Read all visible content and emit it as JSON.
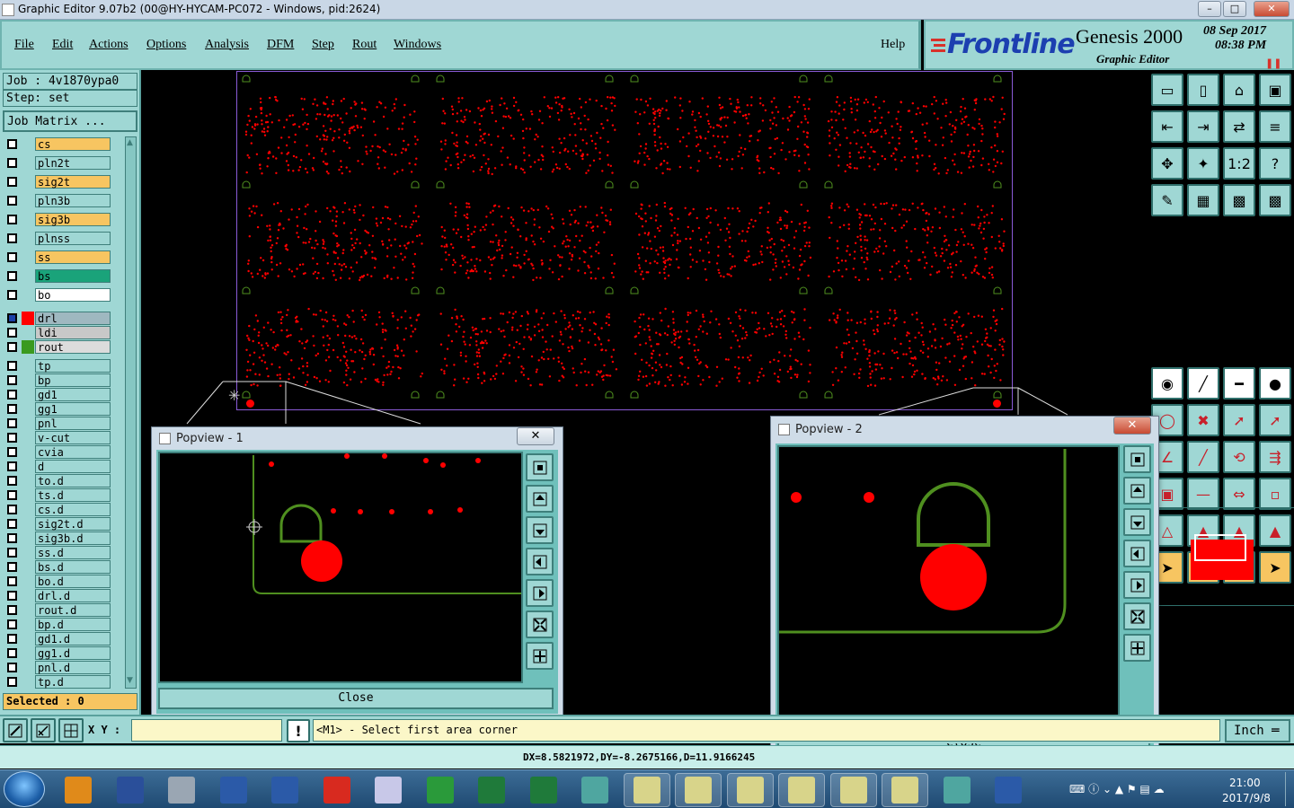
{
  "window": {
    "title": "Graphic Editor 9.07b2 (00@HY-HYCAM-PC072 - Windows, pid:2624)"
  },
  "menu": {
    "items": [
      "File",
      "Edit",
      "Actions",
      "Options",
      "Analysis",
      "DFM",
      "Step",
      "Rout",
      "Windows"
    ],
    "help": "Help"
  },
  "brand": {
    "logo": "Frontline",
    "product": "Genesis 2000",
    "subtitle": "Graphic Editor",
    "date": "08 Sep 2017",
    "time": "08:38 PM"
  },
  "job": {
    "job_label": "Job : 4v1870ypa0",
    "step_label": "Step: set",
    "matrix_button": "Job Matrix ..."
  },
  "layers": [
    {
      "name": "cs",
      "color": "#f7c561"
    },
    {
      "name": "pln2t",
      "color": "#9fd7d4"
    },
    {
      "name": "sig2t",
      "color": "#f7c561"
    },
    {
      "name": "pln3b",
      "color": "#9fd7d4"
    },
    {
      "name": "sig3b",
      "color": "#f7c561"
    },
    {
      "name": "plnss",
      "color": "#9fd7d4"
    },
    {
      "name": "ss",
      "color": "#f7c561"
    },
    {
      "name": "bs",
      "color": "#1aa37a"
    },
    {
      "name": "bo",
      "color": "#ffffff"
    },
    {
      "name": "drl",
      "color": "#9fb8c0",
      "swatch": "#ff0000",
      "selected": true
    },
    {
      "name": "ldi",
      "color": "#c8c8c8"
    },
    {
      "name": "rout",
      "color": "#dcdcdc",
      "swatch": "#3a9a1f"
    },
    {
      "name": "tp",
      "color": "#9fd7d4"
    },
    {
      "name": "bp",
      "color": "#9fd7d4"
    },
    {
      "name": "gd1",
      "color": "#9fd7d4"
    },
    {
      "name": "gg1",
      "color": "#9fd7d4"
    },
    {
      "name": "pnl",
      "color": "#9fd7d4"
    },
    {
      "name": "v-cut",
      "color": "#9fd7d4"
    },
    {
      "name": "cvia",
      "color": "#9fd7d4"
    },
    {
      "name": "d",
      "color": "#9fd7d4"
    },
    {
      "name": "to.d",
      "color": "#9fd7d4"
    },
    {
      "name": "ts.d",
      "color": "#9fd7d4"
    },
    {
      "name": "cs.d",
      "color": "#9fd7d4"
    },
    {
      "name": "sig2t.d",
      "color": "#9fd7d4"
    },
    {
      "name": "sig3b.d",
      "color": "#9fd7d4"
    },
    {
      "name": "ss.d",
      "color": "#9fd7d4"
    },
    {
      "name": "bs.d",
      "color": "#9fd7d4"
    },
    {
      "name": "bo.d",
      "color": "#9fd7d4"
    },
    {
      "name": "drl.d",
      "color": "#9fd7d4"
    },
    {
      "name": "rout.d",
      "color": "#9fd7d4"
    },
    {
      "name": "bp.d",
      "color": "#9fd7d4"
    },
    {
      "name": "gd1.d",
      "color": "#9fd7d4"
    },
    {
      "name": "gg1.d",
      "color": "#9fd7d4"
    },
    {
      "name": "pnl.d",
      "color": "#9fd7d4"
    },
    {
      "name": "tp.d",
      "color": "#9fd7d4"
    }
  ],
  "selected_count": "Selected : 0",
  "popview1": {
    "title": "Popview - 1",
    "close_label": "Close"
  },
  "popview2": {
    "title": "Popview - 2",
    "close_label": "Close"
  },
  "command": {
    "xy_label": "X Y :",
    "xy_value": "",
    "prompt": "<M1> - Select first area corner",
    "units": "Inch"
  },
  "status": {
    "measure": "DX=8.5821972,DY=-8.2675166,D=11.9166245"
  },
  "taskbar": {
    "time": "21:00",
    "date": "2017/9/8"
  },
  "colors": {
    "panel": "#9fd7d4",
    "highlight": "#f7c561",
    "drill": "#ff0000",
    "rout": "#4f8f1f",
    "canvas": "#000000"
  }
}
